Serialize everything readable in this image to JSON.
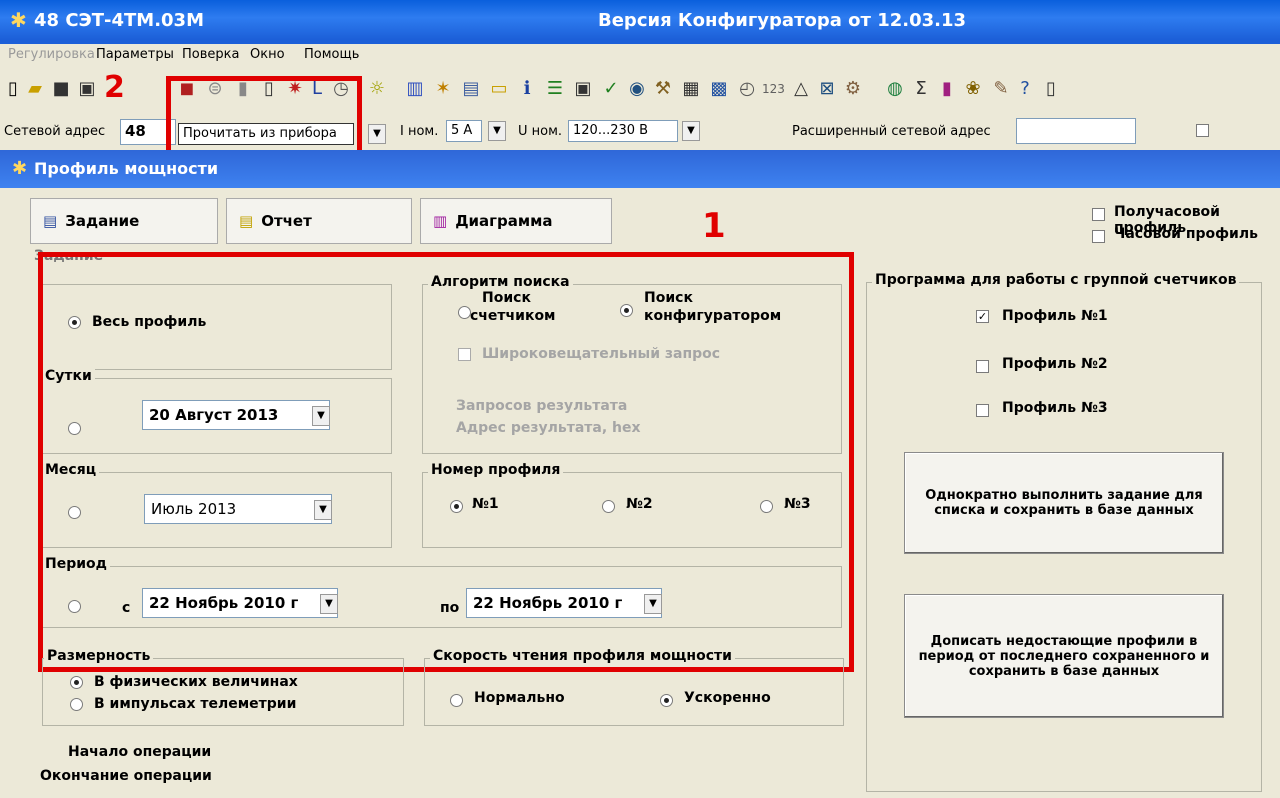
{
  "titlebar": {
    "left": "48  СЭТ-4ТМ.03М",
    "center": "Версия Конфигуратора  от 12.03.13"
  },
  "menu": [
    {
      "label": "Регулировка",
      "enabled": false
    },
    {
      "label": "Параметры",
      "enabled": true
    },
    {
      "label": "Поверка",
      "enabled": true
    },
    {
      "label": "Окно",
      "enabled": true
    },
    {
      "label": "Помощь",
      "enabled": true
    }
  ],
  "toolbar": {
    "tooltip": "Прочитать из прибора",
    "annotation": "2"
  },
  "addr_row": {
    "net_addr_label": "Сетевой адрес",
    "net_addr_value": "48",
    "inom_label": "I ном.",
    "inom_value": "5 А",
    "unom_label": "U ном.",
    "unom_value": "120...230 В",
    "ext_addr_label": "Расширенный сетевой адрес"
  },
  "child_title": "Профиль мощности",
  "tabs": {
    "task": "Задание",
    "report": "Отчет",
    "diagram": "Диаграмма"
  },
  "top_checks": {
    "half_hour": "Получасовой профиль",
    "hour": "Часовой профиль"
  },
  "annotation_1": "1",
  "task_group_label": "Задание",
  "whole_profile": "Весь профиль",
  "day": {
    "label": "Сутки",
    "date": "20  Август  2013"
  },
  "month": {
    "label": "Месяц",
    "value": "Июль   2013"
  },
  "period": {
    "label": "Период",
    "from_label": "с",
    "from": "22  Ноябрь  2010 г",
    "to_label": "по",
    "to": "22  Ноябрь  2010 г"
  },
  "search_algo": {
    "label": "Алгоритм поиска",
    "by_meter": "Поиск\nсчетчиком",
    "by_meter_l1": "Поиск",
    "by_meter_l2": "счетчиком",
    "by_conf_l1": "Поиск",
    "by_conf_l2": "конфигуратором",
    "broadcast": "Широковещательный запрос",
    "requests": "Запросов результата",
    "addr_hex": "Адрес результата, hex"
  },
  "profile_num": {
    "label": "Номер профиля",
    "p1": "№1",
    "p2": "№2",
    "p3": "№3"
  },
  "dimension": {
    "label": "Размерность",
    "phys": "В физических величинах",
    "pulse": "В импульсах телеметрии"
  },
  "speed": {
    "label": "Скорость чтения профиля мощности",
    "normal": "Нормально",
    "fast": "Ускоренно"
  },
  "group_prog": {
    "label": "Программа для работы с группой счетчиков",
    "p1": "Профиль №1",
    "p2": "Профиль №2",
    "p3": "Профиль №3",
    "btn1": "Однократно выполнить задание для списка и сохранить в базе данных",
    "btn2": "Дописать недостающие профили в период от последнего сохраненного и сохранить в базе данных"
  },
  "op": {
    "start": "Начало операции",
    "end": "Окончание операции"
  },
  "colors": {
    "annotation": "#e00000",
    "title_blue": "#1c5fd8"
  }
}
